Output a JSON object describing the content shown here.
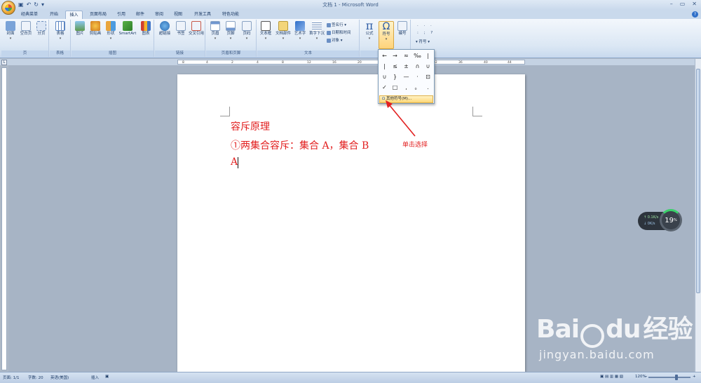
{
  "window": {
    "title": "文档 1 - Microsoft Word",
    "qat_icons": [
      "save-icon",
      "undo-icon",
      "redo-icon"
    ],
    "controls": [
      "minimize-icon",
      "maximize-icon",
      "close-icon"
    ]
  },
  "tabs": [
    {
      "label": "经典菜单",
      "active": false
    },
    {
      "label": "开始",
      "active": false
    },
    {
      "label": "插入",
      "active": true
    },
    {
      "label": "页面布局",
      "active": false
    },
    {
      "label": "引用",
      "active": false
    },
    {
      "label": "邮件",
      "active": false
    },
    {
      "label": "审阅",
      "active": false
    },
    {
      "label": "视图",
      "active": false
    },
    {
      "label": "开发工具",
      "active": false
    },
    {
      "label": "特色功能",
      "active": false
    }
  ],
  "ribbon": {
    "groups": {
      "page": "页",
      "table": "表格",
      "illustrations": "插图",
      "links": "链接",
      "header_footer": "页眉和页脚",
      "text": "文本",
      "symbols": "符号"
    },
    "buttons": {
      "cover": "封面",
      "blank_page": "空白页",
      "page_break": "分页",
      "table": "表格",
      "picture": "图片",
      "clipart": "剪贴画",
      "shapes": "形状",
      "smartart": "SmartArt",
      "chart": "图表",
      "hyperlink": "超链接",
      "bookmark": "书签",
      "crossref": "交叉引用",
      "header": "页眉",
      "footer": "页脚",
      "page_number": "页码",
      "textbox": "文本框",
      "quickparts": "文档部件",
      "wordart": "艺术字",
      "dropcap": "首字下沉",
      "signature": "签名行",
      "datetime": "日期和时间",
      "object": "对象",
      "equation": "公式",
      "symbol": "符号",
      "numbering": "编号",
      "symbol_small": "符号"
    }
  },
  "symbol_dropdown": {
    "symbols": [
      "←",
      "→",
      "≈",
      "‰",
      "|",
      "|",
      "≤",
      "±",
      "∩",
      "∪",
      "∪",
      "}",
      "—",
      "·",
      "⊡",
      "✓",
      "□",
      ",",
      "。",
      "."
    ],
    "more_label": "其他符号(M)..."
  },
  "document": {
    "lines": [
      "容斥原理",
      "①两集合容斥：集合 A，集合 B",
      "A"
    ]
  },
  "annotation": {
    "label": "单击选择"
  },
  "network_widget": {
    "up": "0.1K/s",
    "down": "0K/s",
    "percent": "19",
    "percent_unit": "%"
  },
  "watermark": {
    "brand": "Bai",
    "brand2": "du",
    "cn": "经验",
    "url": "jingyan.baidu.com"
  },
  "statusbar": {
    "page": "页面: 1/1",
    "words": "字数: 20",
    "language": "英语(美国)",
    "mode": "插入",
    "zoom": "120%"
  },
  "colors": {
    "doc_text": "#e22020",
    "annotation": "#e22020",
    "ribbon_bg": "#dbe7f4"
  }
}
